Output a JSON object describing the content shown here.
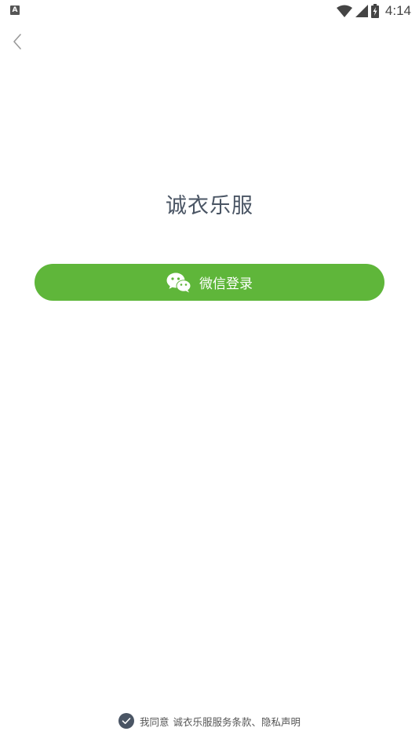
{
  "status_bar": {
    "notification_icon_letter": "A",
    "time": "4:14",
    "icons": [
      "wifi-icon",
      "cell-signal-icon",
      "battery-charging-icon"
    ]
  },
  "nav": {
    "back_icon": "chevron-left-icon"
  },
  "app": {
    "title": "诚衣乐服"
  },
  "login": {
    "wechat_label": "微信登录",
    "wechat_icon": "wechat-icon",
    "button_color": "#5fb63a"
  },
  "agreement": {
    "checked": true,
    "prefix": "我同意",
    "link": "诚衣乐服服务条款、隐私声明",
    "check_color": "#4a5564"
  }
}
